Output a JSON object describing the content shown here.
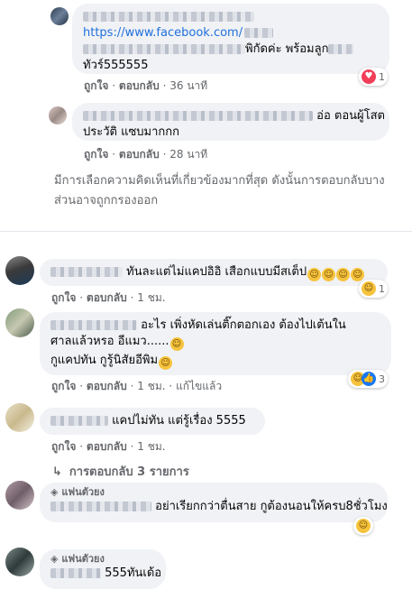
{
  "actions": {
    "like": "ถูกใจ",
    "reply": "ตอบกลับ",
    "edit": "แก้ไขแล้ว",
    "sep": "·"
  },
  "comments": [
    {
      "url": "https://www.facebook.com/",
      "text_line1_tail": "พิกัดค่ะ พร้อมลูก",
      "text_line2": "ทัวร์555555",
      "time": "36 นาที",
      "reaction_count": "1"
    },
    {
      "text_line1_tail": "อ่อ ตอนผู้โสต",
      "text_line2": "ประวัติ แซบมากกก",
      "time": "28 นาที"
    },
    {
      "text": "ทันละแต่ไม่แคปอิอิ เสือกแบบมีสเต็ป",
      "time": "1 ชม.",
      "reaction_count": "1"
    },
    {
      "text_line1_tail": "อะไร เพิ่งหัดเล่นติ๊กตอกเอง ต้องไปเต้นใน",
      "text_line2": "ศาลแล้วหรอ อีแมว......",
      "text_line3": "กูแคปทัน กูรู้นิสัยอีพิม",
      "time": "1 ชม.",
      "reaction_count": "3"
    },
    {
      "text": "แคปไม่ทัน แต่รู้เรื่อง 5555",
      "time": "1 ชม."
    },
    {
      "badge": "แฟนตัวยง",
      "text": "อย่าเรียกกว่าตื่นสาย กูต้องนอนให้ครบ8ชั่วโมง"
    },
    {
      "badge": "แฟนตัวยง",
      "text": "555ทันเด้อ"
    }
  ],
  "relevance_note": "มีการเลือกความคิดเห็นที่เกี่ยวข้องมากที่สุด ดังนั้นการตอบกลับบางส่วนอาจถูกกรองออก",
  "view_replies": "การตอบกลับ 3 รายการ",
  "icons": {
    "love": "love-reaction-icon",
    "haha": "haha-reaction-icon",
    "like": "like-reaction-icon",
    "reply_arrow": "reply-arrow-icon",
    "diamond": "diamond-badge-icon"
  },
  "colors": {
    "bubble": "#f0f2f5",
    "secondary_text": "#65676b",
    "link": "#216fdb",
    "love": "#f33e58",
    "haha": "#f7c33d",
    "like": "#1877f2"
  }
}
